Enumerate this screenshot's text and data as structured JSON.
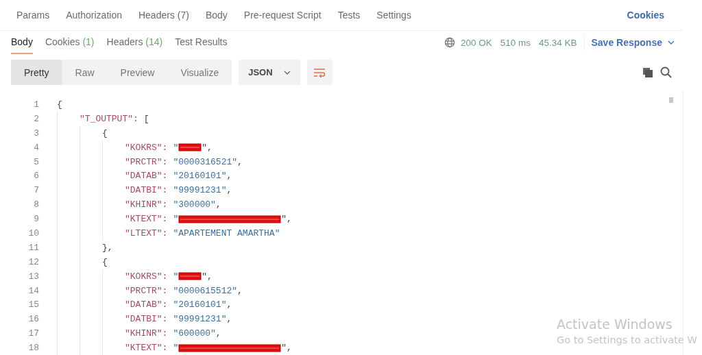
{
  "request_tabs": [
    {
      "label": "Params",
      "selected": false
    },
    {
      "label": "Authorization",
      "selected": false
    },
    {
      "label": "Headers",
      "count": "(7)",
      "selected": false
    },
    {
      "label": "Body",
      "selected": false
    },
    {
      "label": "Pre-request Script",
      "selected": false
    },
    {
      "label": "Tests",
      "selected": false
    },
    {
      "label": "Settings",
      "selected": false
    }
  ],
  "cookies_link": "Cookies",
  "response_tabs": [
    {
      "label": "Body",
      "selected": true
    },
    {
      "label": "Cookies",
      "count": "(1)",
      "selected": false
    },
    {
      "label": "Headers",
      "count": "(14)",
      "selected": false
    },
    {
      "label": "Test Results",
      "selected": false
    }
  ],
  "status": {
    "code": "200 OK",
    "time": "510 ms",
    "size": "45.34 KB"
  },
  "save_response": "Save Response",
  "view_modes": [
    {
      "label": "Pretty",
      "selected": true
    },
    {
      "label": "Raw",
      "selected": false
    },
    {
      "label": "Preview",
      "selected": false
    },
    {
      "label": "Visualize",
      "selected": false
    }
  ],
  "format": "JSON",
  "wrap_lines": true,
  "code": [
    {
      "number": "1",
      "text": "{",
      "children": [
        {
          "number": "2",
          "key": "\"T_OUTPUT\":",
          "text": " [",
          "children": [
            {
              "number": "3",
              "text": "{",
              "children": [
                {
                  "number": "4",
                  "key": "\"KOKRS\":",
                  "value": "\"",
                  "redacted": true,
                  "kind": "short",
                  "after": "\","
                },
                {
                  "number": "5",
                  "key": "\"PRCTR\":",
                  "value": "\"0000316521\"",
                  "after": ","
                },
                {
                  "number": "6",
                  "key": "\"DATAB\":",
                  "value": "\"20160101\"",
                  "after": ","
                },
                {
                  "number": "7",
                  "key": "\"DATBI\":",
                  "value": "\"99991231\"",
                  "after": ","
                },
                {
                  "number": "8",
                  "key": "\"KHINR\":",
                  "value": "\"300000\"",
                  "after": ","
                },
                {
                  "number": "9",
                  "key": "\"KTEXT\":",
                  "value": "\"",
                  "redacted": true,
                  "kind": "long",
                  "after": "\","
                },
                {
                  "number": "10",
                  "key": "\"LTEXT\":",
                  "value": "\"APARTEMENT AMARTHA\""
                }
              ]
            },
            {
              "number": "11",
              "text": "},"
            },
            {
              "number": "12",
              "text": "{",
              "children": [
                {
                  "number": "13",
                  "key": "\"KOKRS\":",
                  "value": "\"",
                  "redacted": true,
                  "kind": "short",
                  "after": "\","
                },
                {
                  "number": "14",
                  "key": "\"PRCTR\":",
                  "value": "\"0000615512\"",
                  "after": ","
                },
                {
                  "number": "15",
                  "key": "\"DATAB\":",
                  "value": "\"20160101\"",
                  "after": ","
                },
                {
                  "number": "16",
                  "key": "\"DATBI\":",
                  "value": "\"99991231\"",
                  "after": ","
                },
                {
                  "number": "17",
                  "key": "\"KHINR\":",
                  "value": "\"600000\"",
                  "after": ","
                },
                {
                  "number": "18",
                  "key": "\"KTEXT\":",
                  "value": "\"",
                  "redacted": true,
                  "kind": "long",
                  "after": "\","
                }
              ]
            }
          ]
        }
      ]
    }
  ],
  "os_notice": {
    "title": "Activate Windows",
    "subtitle": "Go to Settings to activate W"
  }
}
